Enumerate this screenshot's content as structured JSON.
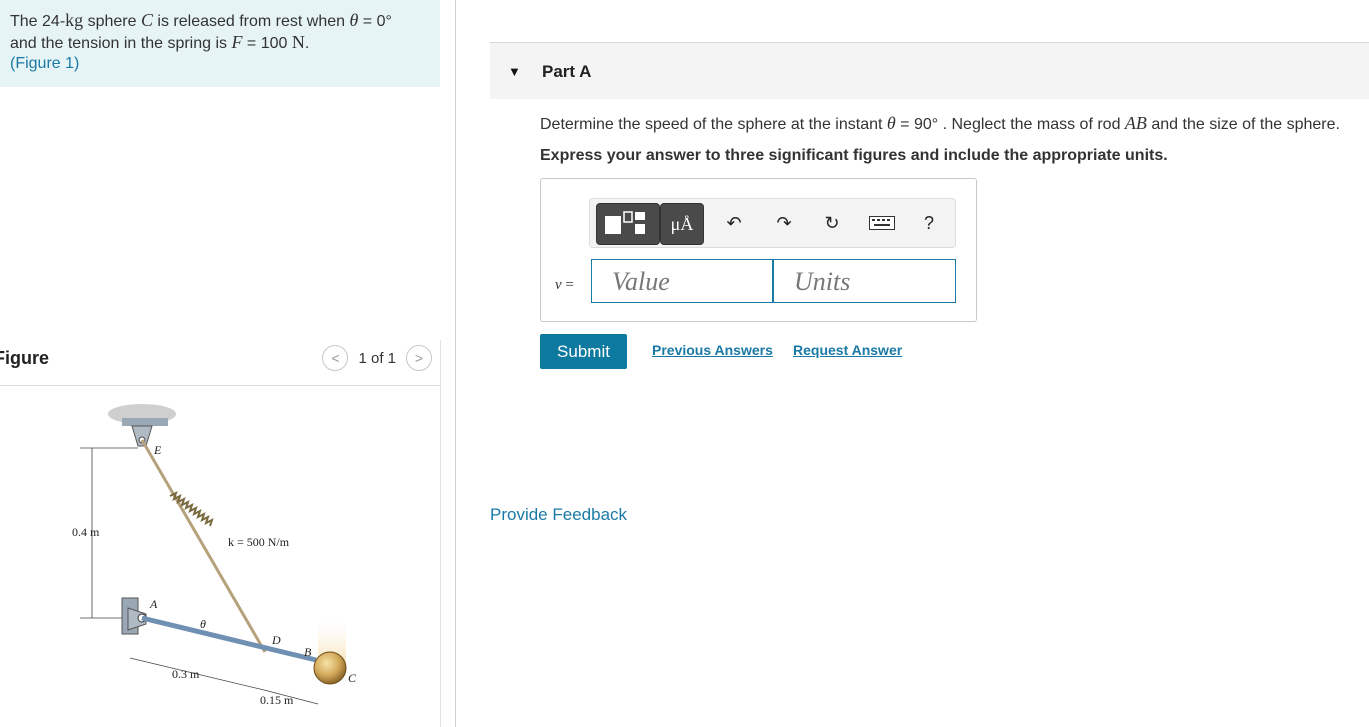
{
  "problem": {
    "line1_pre": "The 24-",
    "line1_unit": "kg",
    "line1_mid": " sphere ",
    "line1_var": "C",
    "line1_post": " is released from rest when ",
    "line1_theta": "θ",
    "line1_value": " = 0°",
    "line2_pre": "and the tension in the spring is ",
    "line2_var": "F",
    "line2_value": " = 100 ",
    "line2_unit": "N",
    "line2_end": ".",
    "figure_link": "(Figure 1)"
  },
  "figure": {
    "title": "Figure",
    "pager_text": "1 of 1",
    "prev_icon": "<",
    "next_icon": ">",
    "labels": {
      "E": "E",
      "A": "A",
      "B": "B",
      "C": "C",
      "D": "D",
      "theta": "θ",
      "height": "0.4 m",
      "spring": "k = 500 N/m",
      "dist1": "0.3 m",
      "dist2": "0.15 m"
    }
  },
  "part": {
    "caret": "▼",
    "title": "Part A",
    "question_pre": "Determine the speed of the sphere at the instant ",
    "question_theta": "θ",
    "question_value": " = 90° ",
    "question_mid": ". Neglect the mass of rod ",
    "question_rod": "AB",
    "question_post": " and the size of the sphere.",
    "instruction": "Express your answer to three significant figures and include the appropriate units."
  },
  "answer": {
    "variable": "v",
    "equals": " =",
    "value_placeholder": "Value",
    "units_placeholder": "Units",
    "toolbar": {
      "mu_label": "μÅ",
      "undo_icon": "↶",
      "redo_icon": "↷",
      "reset_icon": "↻",
      "help_label": "?"
    }
  },
  "actions": {
    "submit": "Submit",
    "previous_answers": "Previous Answers",
    "request_answer": "Request Answer",
    "provide_feedback": "Provide Feedback"
  }
}
